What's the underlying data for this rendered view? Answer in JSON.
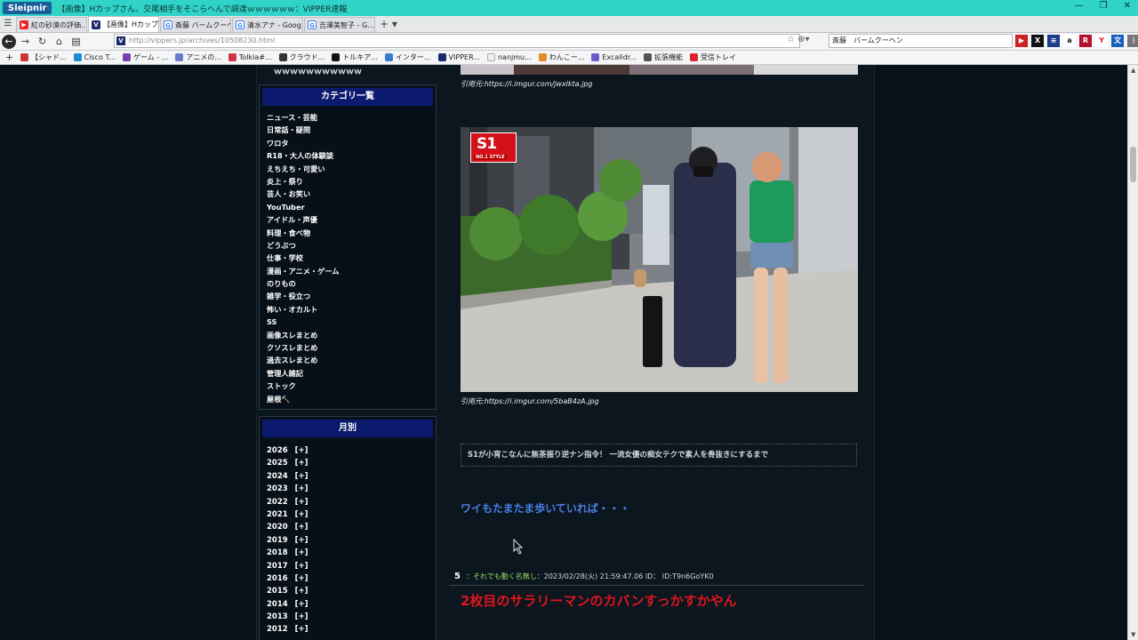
{
  "window": {
    "app_name": "Sleipnir",
    "title": "【画像】Hカップさん、交尾相手をそこらへんで調達ｗｗｗｗｗｗ：VIPPER速報",
    "controls": [
      "—",
      "❐",
      "✕"
    ]
  },
  "tabs": [
    {
      "label": "紅の砂漠の評価...",
      "icon": "youtube-icon"
    },
    {
      "label": "【画像】Hカップさ...",
      "icon": "vipper-icon",
      "active": true
    },
    {
      "label": "斎藤 バームクーヘ...",
      "icon": "google-icon"
    },
    {
      "label": "清水アナ - Goog...",
      "icon": "google-icon"
    },
    {
      "label": "吉澤美智子 - G...",
      "icon": "google-icon"
    }
  ],
  "tab_add_label": "+ ▾",
  "nav": {
    "url": "http://vippers.jp/archives/10508230.html",
    "search_value": "斎藤　バームクーヘン"
  },
  "bookmarks": [
    {
      "label": "【シャド...",
      "color": "#c33"
    },
    {
      "label": "Cisco T...",
      "color": "#1b8fd0"
    },
    {
      "label": "ゲーム - ...",
      "color": "#7a3fb0"
    },
    {
      "label": "アニメの...",
      "color": "#6a7bd0"
    },
    {
      "label": "Tolkia#...",
      "color": "#d0344a"
    },
    {
      "label": "クラウド...",
      "color": "#333"
    },
    {
      "label": "トルキア...",
      "color": "#111"
    },
    {
      "label": "インター...",
      "color": "#3c7cd0"
    },
    {
      "label": "VIPPER...",
      "color": "#1a2a6c"
    },
    {
      "label": "nanjmu...",
      "color": "#eee"
    },
    {
      "label": "わんこー...",
      "color": "#e48a2a"
    },
    {
      "label": "Excalidr...",
      "color": "#6a5acd"
    },
    {
      "label": "拡張機能",
      "color": "#555"
    },
    {
      "label": "受信トレイ",
      "color": "#d23"
    }
  ],
  "sidebar": {
    "top_text": "ｗｗｗｗｗｗｗｗｗｗｗ",
    "categories_title": "カテゴリ一覧",
    "categories": [
      "ニュース・芸能",
      "日常話・疑問",
      "ワロタ",
      "R18・大人の体験談",
      "えちえち・可愛い",
      "炎上・祭り",
      "芸人・お笑い",
      "YouTuber",
      "アイドル・声優",
      "料理・食べ物",
      "どうぶつ",
      "仕事・学校",
      "漫画・アニメ・ゲーム",
      "のりもの",
      "雑学・役立つ",
      "怖い・オカルト",
      "SS",
      "画像スレまとめ",
      "クソスレまとめ",
      "過去スレまとめ",
      "管理人雑記",
      "ストック",
      "屋根🔨"
    ],
    "monthly_title": "月別",
    "years": [
      "2026",
      "2025",
      "2024",
      "2023",
      "2022",
      "2021",
      "2020",
      "2019",
      "2018",
      "2017",
      "2016",
      "2015",
      "2014",
      "2013",
      "2012"
    ],
    "expand_label": "[+]"
  },
  "main": {
    "cite1": "引用元:https://i.imgur.com/jwxlkta.jpg",
    "photo_logo_big": "S1",
    "photo_logo_small": "NO.1 STYLE",
    "cite2": "引用元:https://i.imgur.com/5baB4zA.jpg",
    "promo_text": "S1が小宵こなんに無茶振り逆ナン指令！ 一流女優の痴女テクで素人を骨抜きにするまで",
    "promo_link": "ワイもたまたま歩いていれば・・・",
    "post": {
      "number": "5",
      "name": "：それでも動く名無し",
      "meta": "：2023/02/28(火) 21:59:47.06 ID： ID:T9n6GoYK0",
      "body": "2枚目のサラリーマンのカバンすっかすかやん"
    }
  },
  "colors": {
    "titlebar": "#2fd3c8",
    "page_bg": "#081118",
    "widget_head": "#0b1a6e",
    "link_blue": "#4a7ee8",
    "post_red": "#e0151e",
    "name_green": "#9de06a"
  }
}
